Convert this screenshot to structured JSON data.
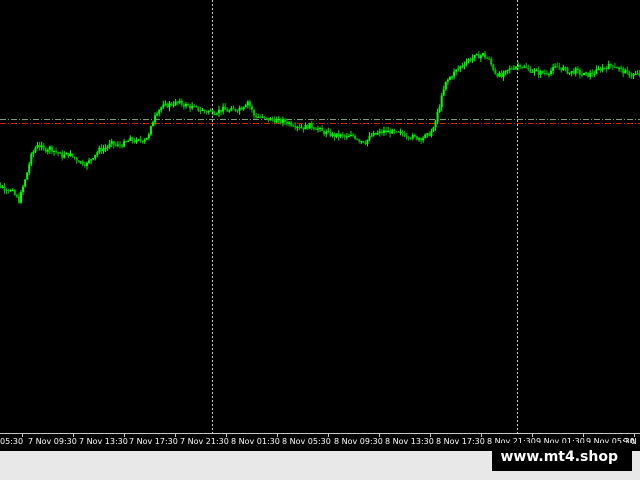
{
  "chart_data": {
    "type": "candlestick",
    "grid": false,
    "colors": {
      "background": "#000000",
      "bullish": "#00ff00",
      "bearish": "#00c000",
      "bid_line": "#7f9f7f",
      "ask_line": "#cc2200",
      "period_separator": "#c8c8c8",
      "axis_text": "#ffffff"
    },
    "x_ticks": [
      "05:30",
      "7 Nov 09:30",
      "7 Nov 13:30",
      "7 Nov 17:30",
      "7 Nov 21:30",
      "8 Nov 01:30",
      "8 Nov 05:30",
      "8 Nov 09:30",
      "8 Nov 13:30",
      "8 Nov 17:30",
      "8 Nov 21:30",
      "9 Nov 01:30",
      "9 Nov 05:30",
      "9 N"
    ],
    "period_separators": [
      "7 Nov 21:30",
      "8 Nov 21:30"
    ],
    "price_level": 0.52,
    "closes": [
      0.21,
      0.2,
      0.19,
      0.18,
      0.16,
      0.12,
      0.22,
      0.34,
      0.4,
      0.37,
      0.38,
      0.36,
      0.34,
      0.35,
      0.33,
      0.31,
      0.3,
      0.34,
      0.37,
      0.38,
      0.4,
      0.39,
      0.4,
      0.42,
      0.41,
      0.42,
      0.44,
      0.55,
      0.58,
      0.59,
      0.6,
      0.6,
      0.59,
      0.58,
      0.57,
      0.56,
      0.56,
      0.56,
      0.57,
      0.56,
      0.57,
      0.58,
      0.61,
      0.54,
      0.53,
      0.52,
      0.52,
      0.51,
      0.51,
      0.5,
      0.49,
      0.48,
      0.49,
      0.48,
      0.46,
      0.45,
      0.44,
      0.44,
      0.43,
      0.44,
      0.42,
      0.41,
      0.44,
      0.45,
      0.46,
      0.46,
      0.45,
      0.45,
      0.44,
      0.43,
      0.43,
      0.44,
      0.47,
      0.59,
      0.7,
      0.74,
      0.77,
      0.8,
      0.82,
      0.83,
      0.84,
      0.81,
      0.75,
      0.73,
      0.76,
      0.78,
      0.79,
      0.77,
      0.76,
      0.75,
      0.75,
      0.76,
      0.78,
      0.77,
      0.75,
      0.76,
      0.74,
      0.74,
      0.75,
      0.77,
      0.78,
      0.79,
      0.77,
      0.75,
      0.74,
      0.74,
      0.73,
      0.74
    ]
  },
  "watermark": "www.mt4.shop"
}
